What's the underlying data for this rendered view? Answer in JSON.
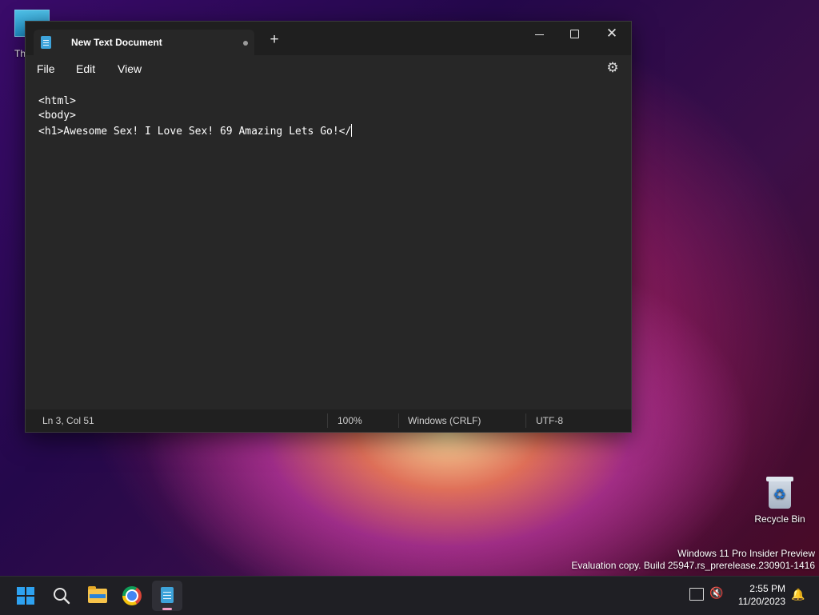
{
  "desktop": {
    "icon_partial_label": "Th",
    "recycle_bin_label": "Recycle Bin",
    "watermark_line1": "Windows 11 Pro Insider Preview",
    "watermark_line2": "Evaluation copy. Build 25947.rs_prerelease.230901-1416"
  },
  "notepad": {
    "tab_title": "New Text Document",
    "new_tab_glyph": "+",
    "menu": [
      "File",
      "Edit",
      "View"
    ],
    "editor_lines": [
      "<html>",
      "<body>",
      "<h1>Awesome Sex! I Love Sex! 69 Amazing Lets Go!</"
    ],
    "status": {
      "position": "Ln 3, Col 51",
      "zoom": "100%",
      "line_endings": "Windows (CRLF)",
      "encoding": "UTF-8"
    }
  },
  "taskbar": {
    "items": [
      "start",
      "search",
      "file-explorer",
      "chrome",
      "notepad"
    ],
    "clock_time": "2:55 PM",
    "clock_date": "11/20/2023"
  },
  "colors": {
    "window_bg": "#272727",
    "titlebar_bg": "#1f1f1f",
    "accent": "#3ea3da",
    "taskbar_bg": "#1f1f24"
  }
}
